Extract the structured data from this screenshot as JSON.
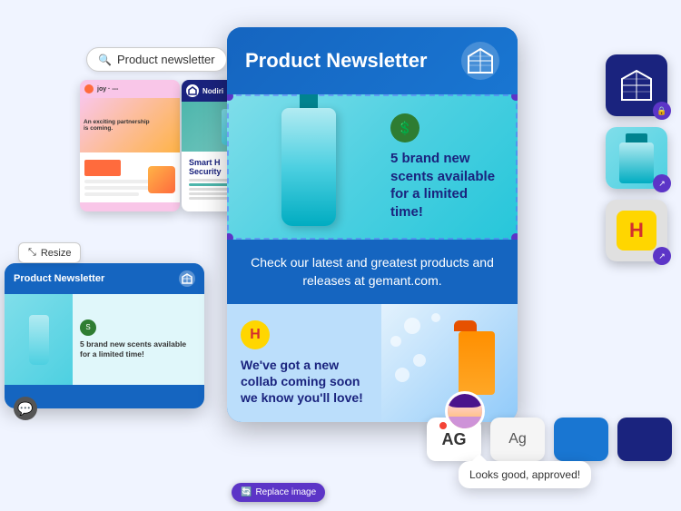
{
  "search": {
    "placeholder": "Product newsletter",
    "icon": "search-icon"
  },
  "resize_btn": {
    "label": "Resize",
    "icon": "resize-icon"
  },
  "mini_templates": [
    {
      "id": "template-1",
      "label": "Colorful partnership newsletter"
    },
    {
      "id": "template-2",
      "label": "Smart Home Security newsletter"
    }
  ],
  "main_card": {
    "title": "Product Newsletter",
    "logo_icon": "geometric-logo-icon",
    "hero": {
      "badge_icon": "scent-badge-icon",
      "text": "5 brand new scents available for a limited time!",
      "replace_btn": "Replace image"
    },
    "middle": {
      "text": "Check our latest and greatest products and releases at gemant.com."
    },
    "bottom": {
      "badge_label": "H",
      "text": "We've got a new collab coming soon we know you'll love!"
    }
  },
  "small_card": {
    "title": "Product Newsletter",
    "badge_text": "S",
    "text": "5 brand new scents available for a limited time!"
  },
  "right_icons": [
    {
      "id": "ri-1",
      "type": "geometric",
      "badge": "lock"
    },
    {
      "id": "ri-2",
      "type": "bottle",
      "badge": "share"
    },
    {
      "id": "ri-3",
      "type": "yellow-h",
      "badge": "share"
    }
  ],
  "bottom_icons": [
    {
      "id": "bi-1",
      "label": "AG",
      "style": "yellow"
    },
    {
      "id": "bi-2",
      "label": "Ag",
      "style": "light"
    },
    {
      "id": "bi-3",
      "label": "",
      "style": "blue"
    },
    {
      "id": "bi-4",
      "label": "",
      "style": "navy"
    }
  ],
  "speech_bubble": {
    "text": "Looks good, approved!"
  },
  "colors": {
    "primary_blue": "#1565c0",
    "accent_purple": "#5c35c7",
    "teal": "#4dd0e1",
    "dark_navy": "#1a237e"
  }
}
